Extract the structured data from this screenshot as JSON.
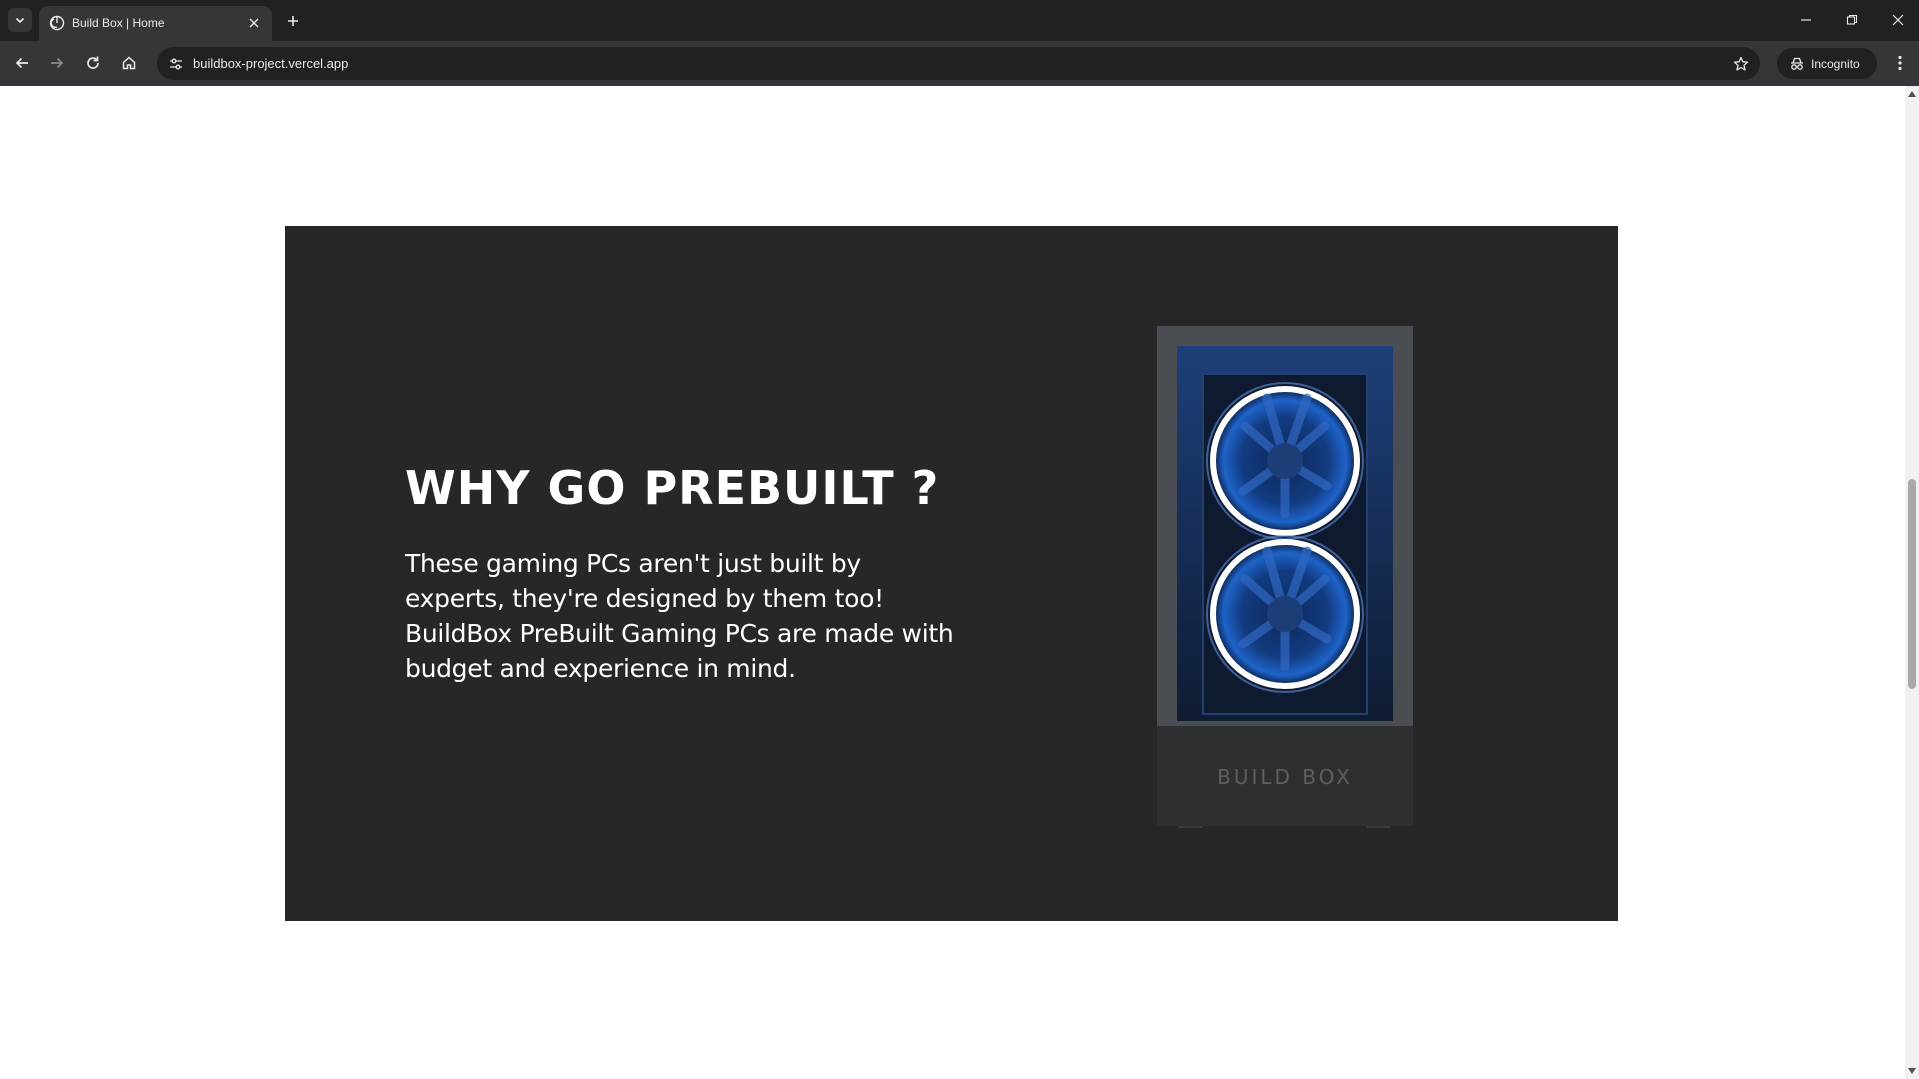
{
  "browser": {
    "tab_title": "Build Box | Home",
    "url": "buildbox-project.vercel.app",
    "incognito_label": "Incognito"
  },
  "icons": {
    "tab_search": "chevron-down-icon",
    "favicon": "globe-icon",
    "tab_close": "close-icon",
    "new_tab": "plus-icon",
    "minimize": "minimize-icon",
    "restore": "restore-icon",
    "close": "close-icon",
    "back": "arrow-left-icon",
    "forward": "arrow-right-icon",
    "reload": "reload-icon",
    "home": "home-icon",
    "site_info": "tune-icon",
    "bookmark": "star-icon",
    "incognito": "incognito-icon",
    "menu": "kebab-menu-icon"
  },
  "section": {
    "heading": "WHY GO PREBUILT ?",
    "paragraph": "These gaming PCs aren't just built by experts, they're designed by them too! BuildBox PreBuilt Gaming PCs are made with budget and experience in mind.",
    "case_logo": "BUILD BOX"
  },
  "colors": {
    "section_bg": "#272727",
    "text": "#ffffff",
    "fan_glow": "#1e63c9"
  }
}
